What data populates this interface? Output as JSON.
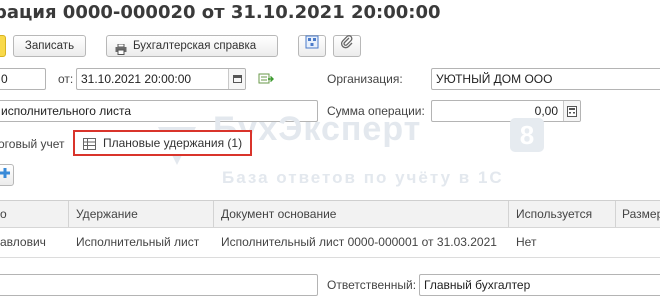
{
  "window": {
    "title": "рация 0000-000020 от 31.10.2021 20:00:00"
  },
  "toolbar": {
    "record_label": "Записать",
    "report_label": "Бухгалтерская справка"
  },
  "form": {
    "number_value": "0",
    "date_label": "от:",
    "date_value": "31.10.2021 20:00:00",
    "org_label": "Организация:",
    "org_value": "УЮТНЫЙ ДОМ ООО",
    "basis_value": "исполнительного листа",
    "sum_label": "Сумма операции:",
    "sum_value": "0,00"
  },
  "tabs": [
    {
      "label": "оговый учет"
    },
    {
      "label": "Плановые удержания (1)"
    }
  ],
  "grid": {
    "columns": [
      "о",
      "Удержание",
      "Документ основание",
      "Используется",
      "Размер"
    ],
    "rows": [
      [
        "авлович",
        "Исполнительный лист",
        "Исполнительный лист 0000-000001 от 31.03.2021",
        "Нет",
        ""
      ]
    ]
  },
  "footer": {
    "resp_label": "Ответственный:",
    "resp_value": "Главный бухгалтер"
  },
  "watermark": {
    "brand": "БухЭксперт",
    "digit": "8",
    "tagline": "База ответов по учёту в 1С"
  },
  "colors": {
    "highlight": "#d9342b",
    "accent_yellow": "#f9d94a",
    "watermark": "#e3e8ee"
  }
}
